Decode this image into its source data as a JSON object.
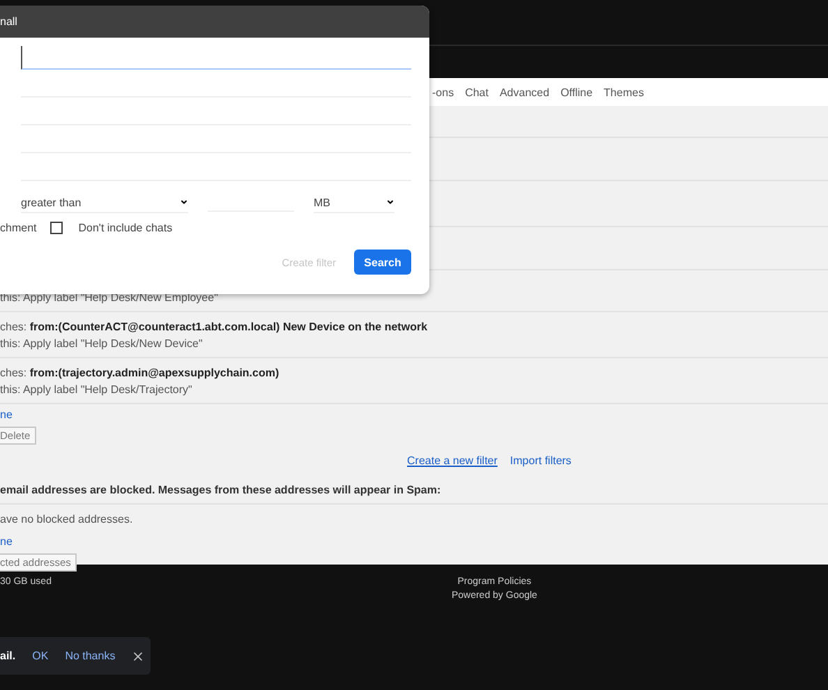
{
  "settings_tabs": [
    {
      "label": "-ons"
    },
    {
      "label": "Chat"
    },
    {
      "label": "Advanced"
    },
    {
      "label": "Offline"
    },
    {
      "label": "Themes"
    }
  ],
  "filters": {
    "partial_action": "this: Apply label \"Help Desk/New Employee\"",
    "items": [
      {
        "match": "ches: **from:(CounterACT@counteract1.abt.com.local) New Device on the network**",
        "action": "this: Apply label \"Help Desk/New Device\""
      },
      {
        "match": "ches: **from:(trajectory.admin@apexsupplychain.com)**",
        "action": "this: Apply label \"Help Desk/Trajectory\""
      }
    ],
    "select_link": "ne",
    "delete_button": "Delete",
    "create_link": "Create a new filter",
    "import_link": "Import filters"
  },
  "blocked": {
    "heading": "email addresses are blocked. Messages from these addresses will appear in Spam:",
    "empty_text": "ave no blocked addresses.",
    "select_link": "ne",
    "unblock_button": "cted addresses"
  },
  "footer": {
    "storage": "30 GB used",
    "links": [
      "Program Policies",
      "Powered by Google"
    ]
  },
  "dialog": {
    "title": "nall",
    "size": {
      "comparator": "greater than",
      "unit": "MB"
    },
    "attachment_label": "chment",
    "chats_checkbox": {
      "label": "Don't include chats",
      "checked": false
    },
    "create_filter": {
      "label": "Create filter",
      "disabled": true
    },
    "search_button": "Search"
  },
  "snackbar": {
    "message": "ail.",
    "ok": "OK",
    "no_thanks": "No thanks"
  }
}
